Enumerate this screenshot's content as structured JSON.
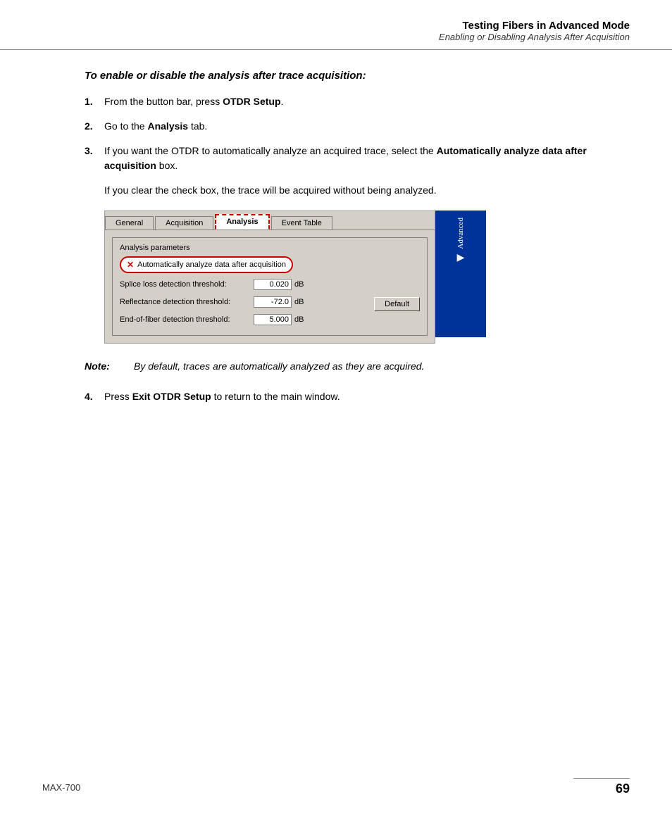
{
  "header": {
    "title": "Testing Fibers in Advanced Mode",
    "subtitle": "Enabling or Disabling Analysis After Acquisition"
  },
  "section_heading": "To enable or disable the analysis after trace acquisition:",
  "steps": [
    {
      "number": "1.",
      "text_before": "From the button bar, press ",
      "bold": "OTDR Setup",
      "text_after": "."
    },
    {
      "number": "2.",
      "text_before": "Go to the ",
      "bold": "Analysis",
      "text_after": " tab."
    },
    {
      "number": "3.",
      "text_before": "If you want the OTDR to automatically analyze an acquired trace, select the ",
      "bold": "Automatically analyze data after acquisition",
      "text_after": " box."
    }
  ],
  "extra_para": "If you clear the check box, the trace will be acquired without being analyzed.",
  "dialog": {
    "tabs": [
      "General",
      "Acquisition",
      "Analysis",
      "Event Table"
    ],
    "active_tab": "Analysis",
    "advanced_label": "Advanced",
    "analysis_params_title": "Analysis parameters",
    "checkbox_label": "Automatically analyze data after acquisition",
    "thresholds": [
      {
        "label": "Splice loss detection threshold:",
        "value": "0.020",
        "unit": "dB"
      },
      {
        "label": "Reflectance detection threshold:",
        "value": "-72.0",
        "unit": "dB"
      },
      {
        "label": "End-of-fiber detection threshold:",
        "value": "5.000",
        "unit": "dB"
      }
    ],
    "default_button": "Default"
  },
  "note": {
    "label": "Note:",
    "text": "By default, traces are automatically analyzed as they are acquired."
  },
  "step4": {
    "number": "4.",
    "text_before": "Press ",
    "bold": "Exit OTDR Setup",
    "text_after": " to return to the main window."
  },
  "footer": {
    "product": "MAX-700",
    "page": "69"
  }
}
